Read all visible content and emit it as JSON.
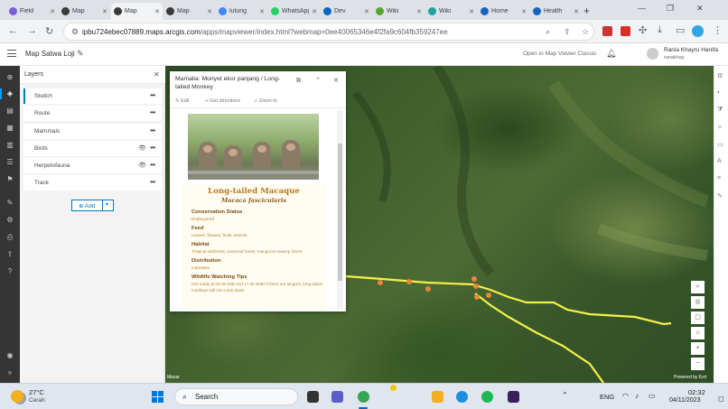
{
  "browser": {
    "tabs": [
      {
        "title": "Field",
        "color": "#7b5cd6",
        "active": false
      },
      {
        "title": "Map",
        "color": "#3a3a3a",
        "active": false
      },
      {
        "title": "Map",
        "color": "#3a3a3a",
        "active": true
      },
      {
        "title": "Map",
        "color": "#3a3a3a",
        "active": false
      },
      {
        "title": "lutung",
        "color": "#4285f4",
        "active": false
      },
      {
        "title": "WhatsApp",
        "color": "#25d366",
        "active": false
      },
      {
        "title": "Dev",
        "color": "#0a66c2",
        "active": false
      },
      {
        "title": "Wiki",
        "color": "#55a630",
        "active": false
      },
      {
        "title": "Wiki",
        "color": "#1aa3a3",
        "active": false
      },
      {
        "title": "Home",
        "color": "#1565c0",
        "active": false
      },
      {
        "title": "Health",
        "color": "#1565c0",
        "active": false
      }
    ],
    "url_host": "ipbu724ebec07889.maps.arcgis.com",
    "url_path": "/apps/mapviewer/index.html?webmap=0ee40065346e4f2fa9c604fb359247ee"
  },
  "app": {
    "title": "Map Satwa Loji",
    "open_classic": "Open in Map Viewer Classic",
    "user_name": "Rania Khayru Hanifa",
    "user_handle": "ranakhay"
  },
  "layers": {
    "title": "Layers",
    "items": [
      {
        "label": "Sketch",
        "visible_icon": false
      },
      {
        "label": "Route",
        "visible_icon": false
      },
      {
        "label": "Mammals",
        "visible_icon": false
      },
      {
        "label": "Birds",
        "visible_icon": true
      },
      {
        "label": "Herpetofauna",
        "visible_icon": true
      },
      {
        "label": "Track",
        "visible_icon": false
      }
    ],
    "add_label": "Add"
  },
  "popup": {
    "title": "Mamalia: Monyet ekor panjang / Long-tailed Monkey",
    "actions": {
      "edit": "Edit",
      "directions": "Get directions",
      "zoom": "Zoom to"
    },
    "species_name": "Long-tailed Macaque",
    "species_latin": "Macaca fascicularis",
    "sections": [
      {
        "heading": "Conservation Status",
        "text": "Endangered"
      },
      {
        "heading": "Feed",
        "text": "Leaves, flowers, fruits, insects"
      },
      {
        "heading": "Habitat",
        "text": "Tropical rainforest, seasonal forest, mangrove-swamp forest"
      },
      {
        "heading": "Distribution",
        "text": "Indonesia"
      },
      {
        "heading": "Wildlife Watching Tips",
        "text": "Get ready at 06.00 WIB and 17.30 WIB! If there are langurs, long-tailed monkeys will not come down"
      }
    ]
  },
  "map": {
    "attribution_left": "Maxar",
    "attribution_right": "Powered by Esri",
    "route_color": "#f4f04a",
    "point_color": "#e8873a"
  },
  "taskbar": {
    "weather_temp": "27°C",
    "weather_desc": "Cerah",
    "search_label": "Search",
    "language": "ENG",
    "time": "02:32",
    "date": "04/11/2023"
  }
}
